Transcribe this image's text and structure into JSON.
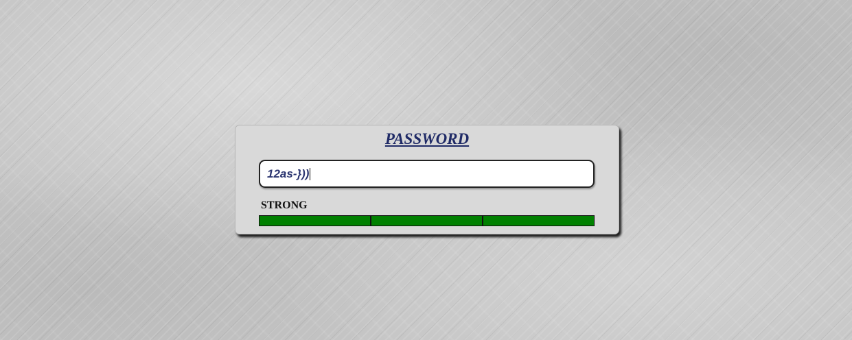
{
  "panel": {
    "title": "PASSWORD"
  },
  "password_field": {
    "value": "12as-}))"
  },
  "strength": {
    "label": "STRONG",
    "segments_total": 3,
    "segments_filled": 3,
    "fill_color": "#008000"
  },
  "colors": {
    "title": "#1f2a66",
    "panel_background": "#d9d9d9",
    "page_background": "#c4c4c4"
  }
}
